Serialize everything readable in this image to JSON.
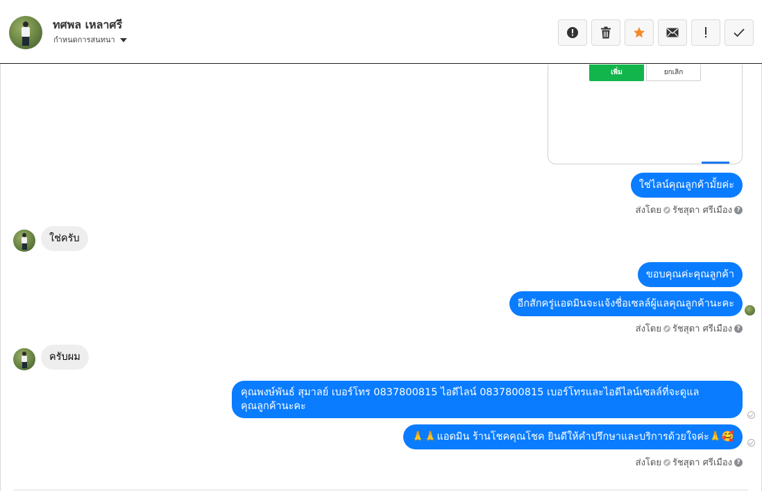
{
  "header": {
    "contact_name": "ทศพล เหลาศรี",
    "subtitle": "กำหนดการสนทนา",
    "actions": [
      {
        "icon": "alert-circle-icon",
        "label": "alert"
      },
      {
        "icon": "trash-icon",
        "label": "delete"
      },
      {
        "icon": "star-icon",
        "label": "star"
      },
      {
        "icon": "envelope-icon",
        "label": "mail"
      },
      {
        "icon": "exclamation-icon",
        "label": "!"
      },
      {
        "icon": "check-icon",
        "label": "done"
      }
    ],
    "star_color": "#f4892a"
  },
  "preview_card": {
    "add_label": "เพิ่ม",
    "cancel_label": "ยกเลิก"
  },
  "messages": {
    "out_1": "ใช่ไลน์คุณลูกค้ามั้ยค่ะ",
    "sent_by_prefix": "ส่งโดย",
    "sent_by_name": "รัชสุดา ศรีเมือง",
    "in_1": "ใช่ครับ",
    "out_2": "ขอบคุณค่ะคุณลูกค้า",
    "out_3": "อีกสักครู่แอดมินจะแจ้งชื่อเซลล์ผู้แลคุณลูกค้านะคะ",
    "in_2": "ครับผม",
    "out_4_line1": "คุณพงษ์พันธ์ สุมาลย์      เบอร์โทร 0837800815  ไอดีไลน์ 0837800815   เบอร์โทรและไอดีไลน์เซลล์ที่จะดูแล",
    "out_4_line2": "คุณลูกค้านะคะ",
    "out_5": "🙏🙏แอดมิน ร้านโชคคุณโชค ยินดีให้คำปรึกษาและบริการด้วยใจค่ะ🙏🥰"
  },
  "colors": {
    "bubble_out": "#0a7cff",
    "bubble_in": "#eeeeee",
    "add_button": "#12b54c"
  }
}
